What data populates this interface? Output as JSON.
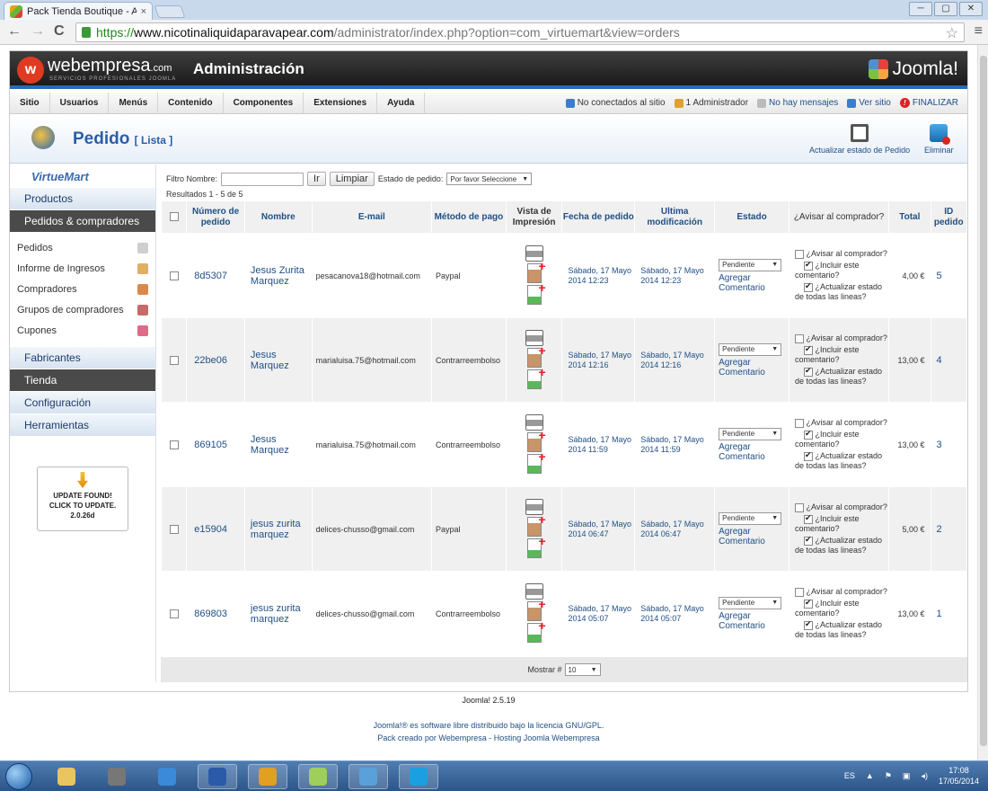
{
  "browser": {
    "tab_title": "Pack Tienda Boutique - A",
    "tab_close": "×",
    "url_scheme": "https://",
    "url_host": "www.nicotinaliquidaparavapear.com",
    "url_path": "/administrator/index.php?option=com_virtuemart&view=orders",
    "win_min": "─",
    "win_max": "▢",
    "win_close": "✕",
    "nav_back": "←",
    "nav_forward": "→",
    "nav_reload": "C",
    "star": "☆",
    "menu": "≡"
  },
  "header": {
    "brand": "webempresa",
    "brand_suffix": ".com",
    "brand_tagline": "SERVICIOS PROFESIONALES JOOMLA",
    "logo_letter": "w",
    "title": "Administración",
    "joomla": "Joomla!"
  },
  "menu": {
    "items": [
      "Sitio",
      "Usuarios",
      "Menús",
      "Contenido",
      "Componentes",
      "Extensiones",
      "Ayuda"
    ],
    "not_connected": "No conectados al sitio",
    "admins": "1 Administrador",
    "messages": "No hay mensajes",
    "view_site": "Ver sitio",
    "logout": "FINALIZAR"
  },
  "titlebar": {
    "title": "Pedido",
    "subtitle": "[ Lista ]",
    "update_btn": "Actualizar estado de Pedido",
    "delete_btn": "Eliminar"
  },
  "sidebar": {
    "logo": "VirtueMart",
    "products": "Productos",
    "orders_section": "Pedidos & compradores",
    "items": [
      {
        "label": "Pedidos",
        "icon": "orders-icon",
        "color": "#cfcfcf"
      },
      {
        "label": "Informe de Ingresos",
        "icon": "report-icon",
        "color": "#e0b060"
      },
      {
        "label": "Compradores",
        "icon": "buyers-icon",
        "color": "#d98a4a"
      },
      {
        "label": "Grupos de compradores",
        "icon": "groups-icon",
        "color": "#c76a6a"
      },
      {
        "label": "Cupones",
        "icon": "coupon-icon",
        "color": "#e06a8a"
      }
    ],
    "manufacturers": "Fabricantes",
    "store": "Tienda",
    "config": "Configuración",
    "tools": "Herramientas",
    "update_l1": "UPDATE FOUND!",
    "update_l2": "CLICK TO UPDATE.",
    "update_l3": "2.0.26d"
  },
  "filter": {
    "label": "Filtro Nombre:",
    "value": "",
    "go": "Ir",
    "clear": "Limpiar",
    "status_label": "Estado de pedido:",
    "status_value": "Por favor Seleccione",
    "results": "Resultados 1 - 5 de 5"
  },
  "table": {
    "headers": {
      "number": "Número de pedido",
      "name": "Nombre",
      "email": "E-mail",
      "payment": "Método de pago",
      "print": "Vista de Impresión",
      "date": "Fecha de pedido",
      "modified": "Ultima modificación",
      "status": "Estado",
      "notify": "¿Avisar al comprador?",
      "total": "Total",
      "id": "ID pedido"
    },
    "add_comment": "Agregar Comentario",
    "notify_opt1": "¿Avisar al comprador?",
    "notify_opt2": "¿Incluir este comentario?",
    "notify_opt3": "¿Actualizar estado de todas las lineas?",
    "rows": [
      {
        "number": "8d5307",
        "name": "Jesus Zurita Marquez",
        "email": "pesacanova18@hotmail.com",
        "payment": "Paypal",
        "date": "Sábado, 17 Mayo 2014 12:23",
        "modified": "Sábado, 17 Mayo 2014 12:23",
        "status": "Pendiente",
        "total": "4,00 €",
        "id": "5"
      },
      {
        "number": "22be06",
        "name": "Jesus Marquez",
        "email": "marialuisa.75@hotmail.com",
        "payment": "Contrarreembolso",
        "date": "Sábado, 17 Mayo 2014 12:16",
        "modified": "Sábado, 17 Mayo 2014 12:16",
        "status": "Pendiente",
        "total": "13,00 €",
        "id": "4"
      },
      {
        "number": "869105",
        "name": "Jesus Marquez",
        "email": "marialuisa.75@hotmail.com",
        "payment": "Contrarreembolso",
        "date": "Sábado, 17 Mayo 2014 11:59",
        "modified": "Sábado, 17 Mayo 2014 11:59",
        "status": "Pendiente",
        "total": "13,00 €",
        "id": "3"
      },
      {
        "number": "e15904",
        "name": "jesus zurita marquez",
        "email": "delices-chusso@gmail.com",
        "payment": "Paypal",
        "date": "Sábado, 17 Mayo 2014 06:47",
        "modified": "Sábado, 17 Mayo 2014 06:47",
        "status": "Pendiente",
        "total": "5,00 €",
        "id": "2"
      },
      {
        "number": "869803",
        "name": "jesus zurita marquez",
        "email": "delices-chusso@gmail.com",
        "payment": "Contrarreembolso",
        "date": "Sábado, 17 Mayo 2014 05:07",
        "modified": "Sábado, 17 Mayo 2014 05:07",
        "status": "Pendiente",
        "total": "13,00 €",
        "id": "1"
      }
    ],
    "show_label": "Mostrar #",
    "show_value": "10"
  },
  "footer": {
    "version": "Joomla! 2.5.19",
    "license": "Joomla!® es software libre distribuido bajo la licencia GNU/GPL.",
    "credits": "Pack creado por Webempresa - Hosting Joomla Webempresa"
  },
  "taskbar": {
    "lang": "ES",
    "time": "17:08",
    "date": "17/05/2014",
    "apps": [
      {
        "icon": "explorer-icon",
        "color": "#e8c560"
      },
      {
        "icon": "gimp-icon",
        "color": "#777777"
      },
      {
        "icon": "ie-icon",
        "color": "#3a8ad8"
      },
      {
        "icon": "word-icon",
        "color": "#2b5aa8"
      },
      {
        "icon": "chrome-icon",
        "color": "#e0a020"
      },
      {
        "icon": "photo-icon",
        "color": "#9fce5a"
      },
      {
        "icon": "messenger-icon",
        "color": "#5aa0d8"
      },
      {
        "icon": "skype-icon",
        "color": "#1aa0e0"
      }
    ]
  }
}
